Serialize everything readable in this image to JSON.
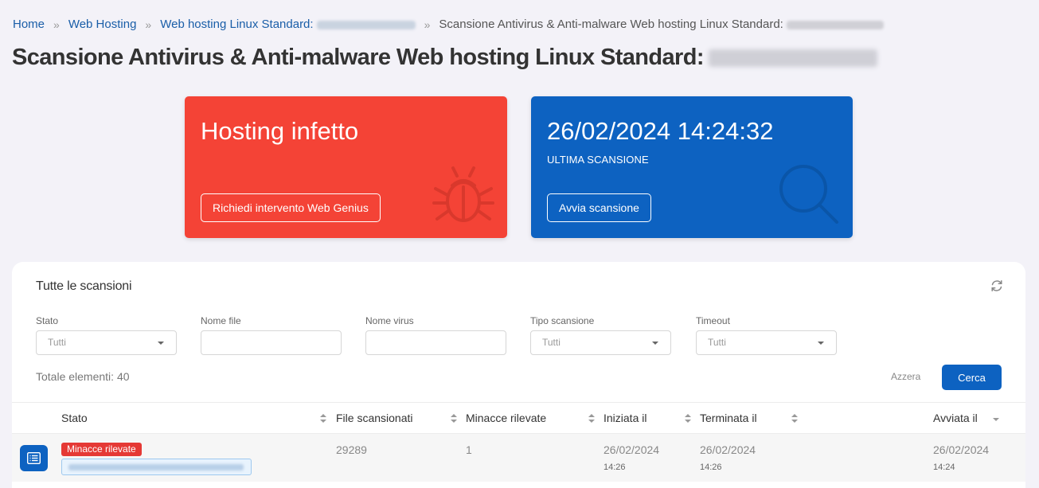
{
  "breadcrumb": {
    "home": "Home",
    "web_hosting": "Web Hosting",
    "linux_standard": "Web hosting Linux Standard:",
    "current": "Scansione Antivirus & Anti-malware Web hosting Linux Standard:"
  },
  "page_title": "Scansione Antivirus & Anti-malware Web hosting Linux Standard:",
  "status_card": {
    "title": "Hosting infetto",
    "button": "Richiedi intervento Web Genius",
    "color": "#f44336",
    "icon": "bug-icon"
  },
  "scan_card": {
    "datetime": "26/02/2024 14:24:32",
    "label": "ULTIMA SCANSIONE",
    "button": "Avvia scansione",
    "color": "#0d62c1",
    "icon": "search-icon"
  },
  "panel": {
    "title": "Tutte le scansioni",
    "filters": {
      "stato": {
        "label": "Stato",
        "value": "Tutti"
      },
      "nome_file": {
        "label": "Nome file",
        "value": ""
      },
      "nome_virus": {
        "label": "Nome virus",
        "value": ""
      },
      "tipo_scansione": {
        "label": "Tipo scansione",
        "value": "Tutti"
      },
      "timeout": {
        "label": "Timeout",
        "value": "Tutti"
      }
    },
    "total": "Totale elementi: 40",
    "reset": "Azzera",
    "search": "Cerca",
    "columns": {
      "stato": "Stato",
      "file": "File scansionati",
      "minacce": "Minacce rilevate",
      "iniziata": "Iniziata il",
      "terminata": "Terminata il",
      "avviata": "Avviata il"
    },
    "rows": [
      {
        "status": "Minacce rilevate",
        "files": "29289",
        "threats": "1",
        "started_date": "26/02/2024",
        "started_time": "14:26",
        "ended_date": "26/02/2024",
        "ended_time": "14:26",
        "launched_date": "26/02/2024",
        "launched_time": "14:24"
      }
    ]
  }
}
